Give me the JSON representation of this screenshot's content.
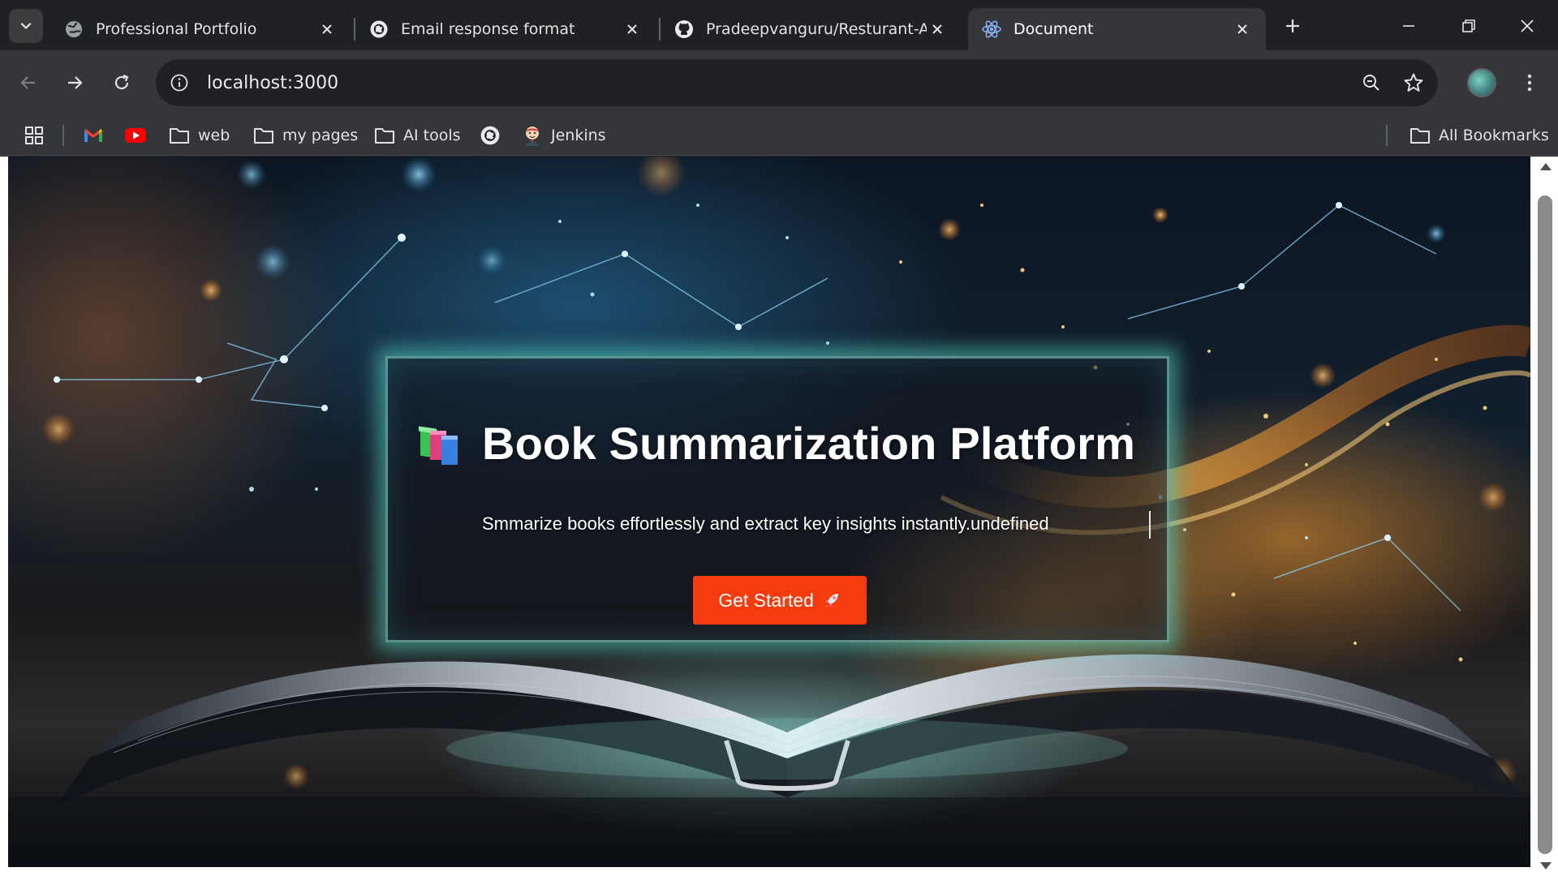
{
  "browser": {
    "tabs": [
      {
        "title": "Professional Portfolio",
        "favicon": "globe-icon",
        "active": false
      },
      {
        "title": "Email response format",
        "favicon": "openai-icon",
        "active": false
      },
      {
        "title": "Pradeepvanguru/Resturant-Ap",
        "favicon": "github-icon",
        "active": false
      },
      {
        "title": "Document",
        "favicon": "react-icon",
        "active": true
      }
    ],
    "url": "localhost:3000",
    "bookmarks": [
      {
        "label": "",
        "icon": "gmail-icon"
      },
      {
        "label": "",
        "icon": "youtube-icon"
      },
      {
        "label": "web",
        "icon": "folder-icon"
      },
      {
        "label": "my pages",
        "icon": "folder-icon"
      },
      {
        "label": "AI tools",
        "icon": "folder-icon"
      },
      {
        "label": "",
        "icon": "openai-icon"
      },
      {
        "label": "Jenkins",
        "icon": "jenkins-icon"
      }
    ],
    "all_bookmarks_label": "All Bookmarks"
  },
  "page": {
    "title": "Book Summarization Platform",
    "title_icon": "books-emoji",
    "subtitle": "Smmarize books effortlessly and extract key insights instantly.undefined",
    "cta_label": "Get Started",
    "cta_icon": "rocket-icon",
    "accent_color": "#f63b0f"
  }
}
